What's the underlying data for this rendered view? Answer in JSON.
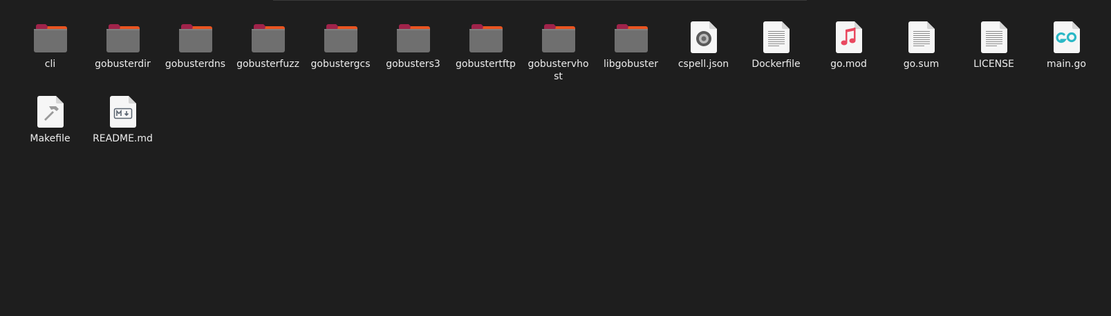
{
  "files": [
    {
      "name": "cli",
      "icon": "folder-icon"
    },
    {
      "name": "gobusterdir",
      "icon": "folder-icon"
    },
    {
      "name": "gobusterdns",
      "icon": "folder-icon"
    },
    {
      "name": "gobusterfuzz",
      "icon": "folder-icon"
    },
    {
      "name": "gobustergcs",
      "icon": "folder-icon"
    },
    {
      "name": "gobusters3",
      "icon": "folder-icon"
    },
    {
      "name": "gobustertftp",
      "icon": "folder-icon"
    },
    {
      "name": "gobustervhost",
      "icon": "folder-icon"
    },
    {
      "name": "libgobuster",
      "icon": "folder-icon"
    },
    {
      "name": "cspell.json",
      "icon": "json-file-icon"
    },
    {
      "name": "Dockerfile",
      "icon": "text-file-icon"
    },
    {
      "name": "go.mod",
      "icon": "music-file-icon"
    },
    {
      "name": "go.sum",
      "icon": "text-file-icon"
    },
    {
      "name": "LICENSE",
      "icon": "text-file-icon"
    },
    {
      "name": "main.go",
      "icon": "go-file-icon"
    },
    {
      "name": "Makefile",
      "icon": "makefile-icon"
    },
    {
      "name": "README.md",
      "icon": "markdown-file-icon"
    }
  ],
  "colors": {
    "background": "#1e1e1e",
    "folder_body": "#6f6f6f",
    "folder_tab_top": "#c2263f",
    "folder_tab_accent": "#e95420",
    "label_text": "#ececec"
  }
}
